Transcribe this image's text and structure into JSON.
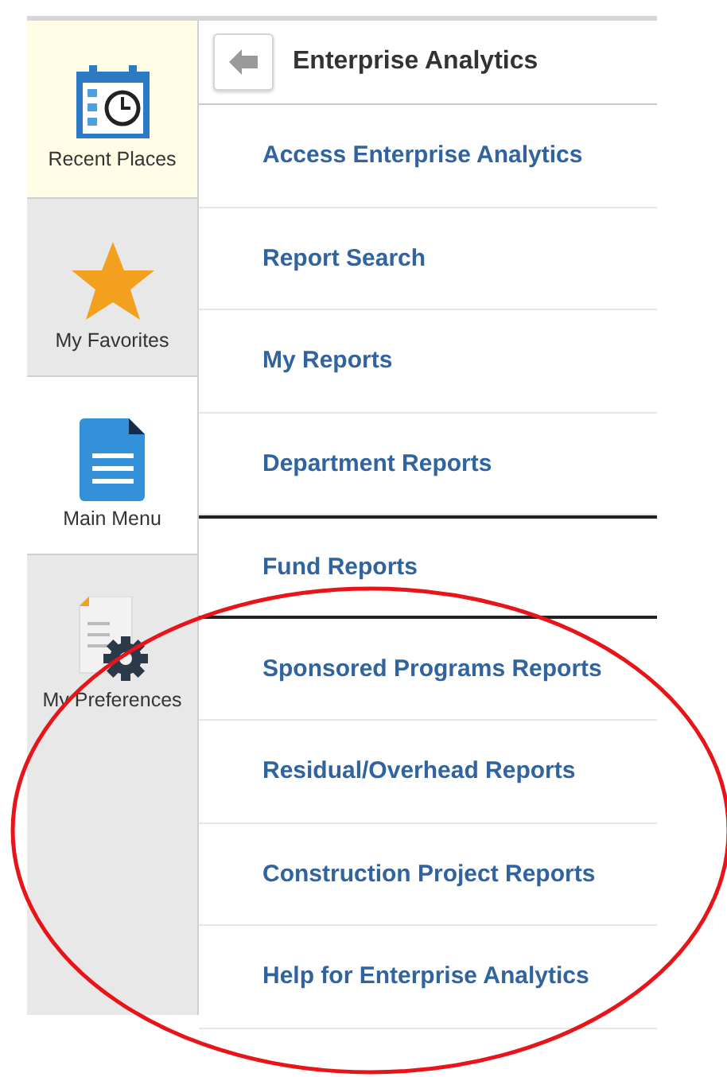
{
  "sidebar": {
    "items": [
      {
        "label": "Recent Places",
        "kind": "calendar",
        "selected": false,
        "hovered": true
      },
      {
        "label": "My Favorites",
        "kind": "star",
        "selected": false,
        "hovered": false
      },
      {
        "label": "Main Menu",
        "kind": "document",
        "selected": true,
        "hovered": false
      },
      {
        "label": "My Preferences",
        "kind": "preferences",
        "selected": false,
        "hovered": false
      }
    ]
  },
  "header": {
    "title": "Enterprise Analytics"
  },
  "menu": {
    "items": [
      {
        "label": "Access Enterprise Analytics",
        "selected": false
      },
      {
        "label": "Report Search",
        "selected": false
      },
      {
        "label": "My Reports",
        "selected": false
      },
      {
        "label": "Department Reports",
        "selected": false
      },
      {
        "label": "Fund Reports",
        "selected": true
      },
      {
        "label": "Sponsored Programs Reports",
        "selected": false
      },
      {
        "label": "Residual/Overhead Reports",
        "selected": false
      },
      {
        "label": "Construction Project Reports",
        "selected": false
      },
      {
        "label": "Help for Enterprise Analytics",
        "selected": false
      }
    ]
  }
}
